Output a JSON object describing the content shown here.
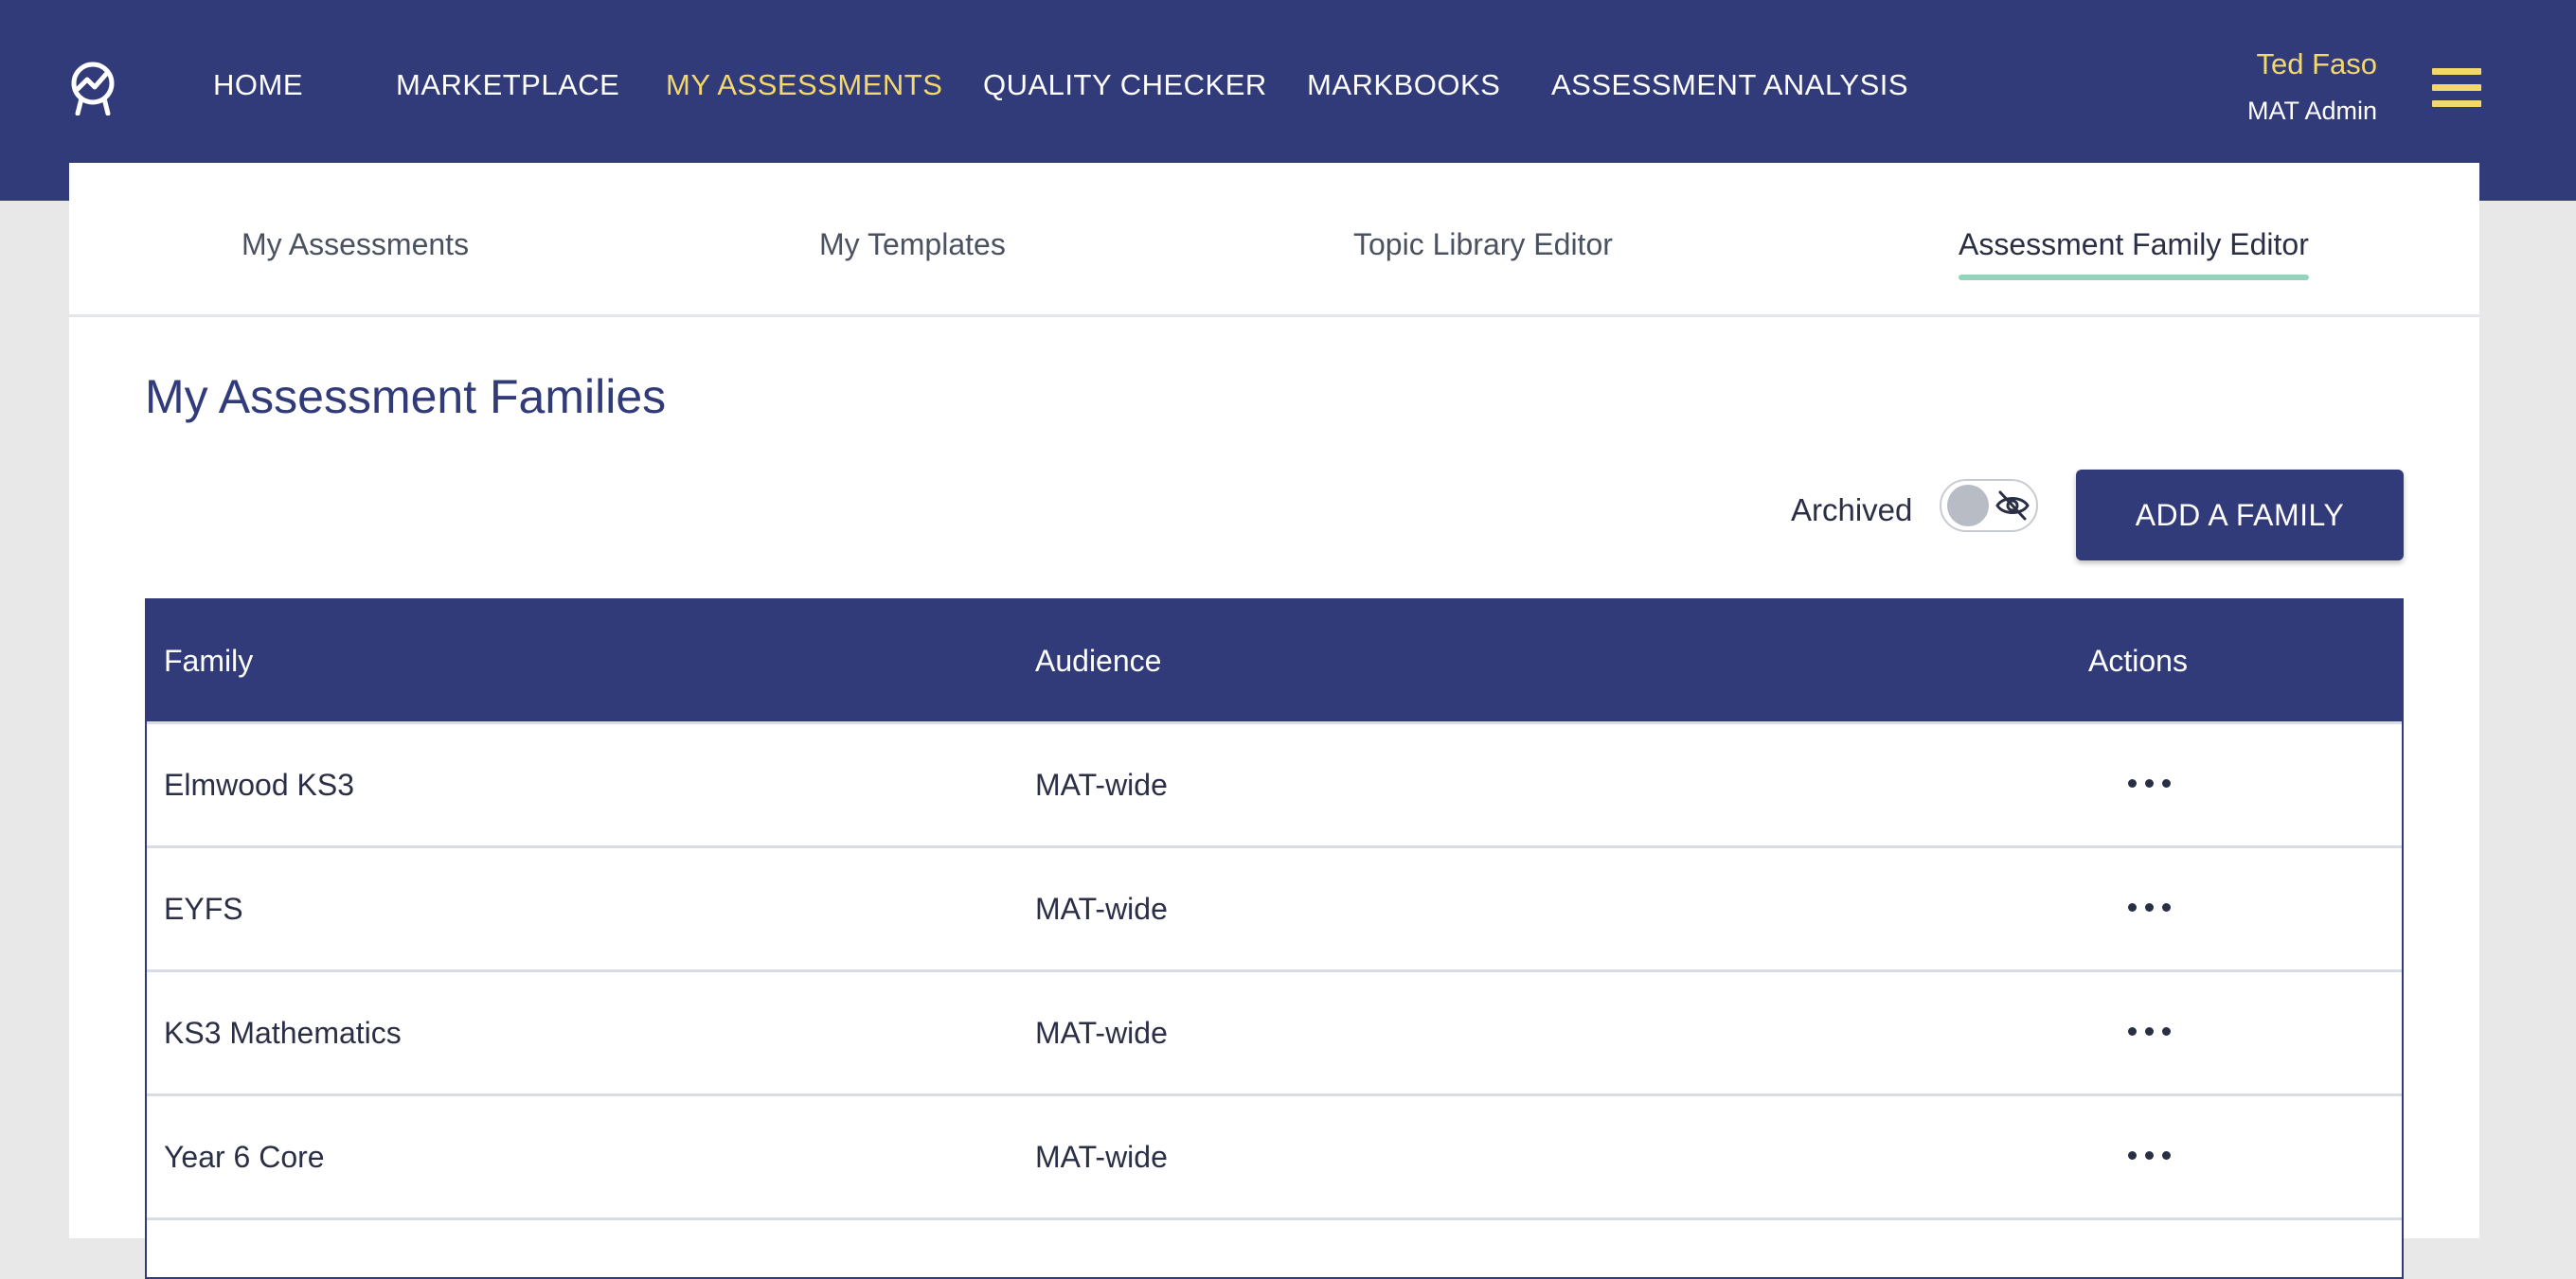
{
  "header": {
    "nav": [
      {
        "label": "HOME",
        "active": false
      },
      {
        "label": "MARKETPLACE",
        "active": false
      },
      {
        "label": "MY ASSESSMENTS",
        "active": true
      },
      {
        "label": "QUALITY CHECKER",
        "active": false
      },
      {
        "label": "MARKBOOKS",
        "active": false
      },
      {
        "label": "ASSESSMENT ANALYSIS",
        "active": false
      }
    ],
    "user": {
      "name": "Ted Faso",
      "role": "MAT Admin"
    }
  },
  "subtabs": [
    {
      "label": "My Assessments",
      "active": false
    },
    {
      "label": "My Templates",
      "active": false
    },
    {
      "label": "Topic Library Editor",
      "active": false
    },
    {
      "label": "Assessment Family Editor",
      "active": true
    }
  ],
  "main": {
    "title": "My Assessment Families",
    "archived_label": "Archived",
    "archived_toggle_on": false,
    "add_button": "ADD A FAMILY"
  },
  "table": {
    "headers": {
      "family": "Family",
      "audience": "Audience",
      "actions": "Actions"
    },
    "rows": [
      {
        "family": "Elmwood KS3",
        "audience": "MAT-wide"
      },
      {
        "family": "EYFS",
        "audience": "MAT-wide"
      },
      {
        "family": "KS3 Mathematics",
        "audience": "MAT-wide"
      },
      {
        "family": "Year 6 Core",
        "audience": "MAT-wide"
      }
    ]
  },
  "colors": {
    "primary": "#323b7a",
    "accent": "#f3d86b",
    "tab_underline": "#8fd4bb"
  },
  "icons": {
    "logo": "logo-icon",
    "menu": "hamburger-icon",
    "toggle": "eye-off-icon",
    "row_actions": "more-horizontal-icon"
  }
}
